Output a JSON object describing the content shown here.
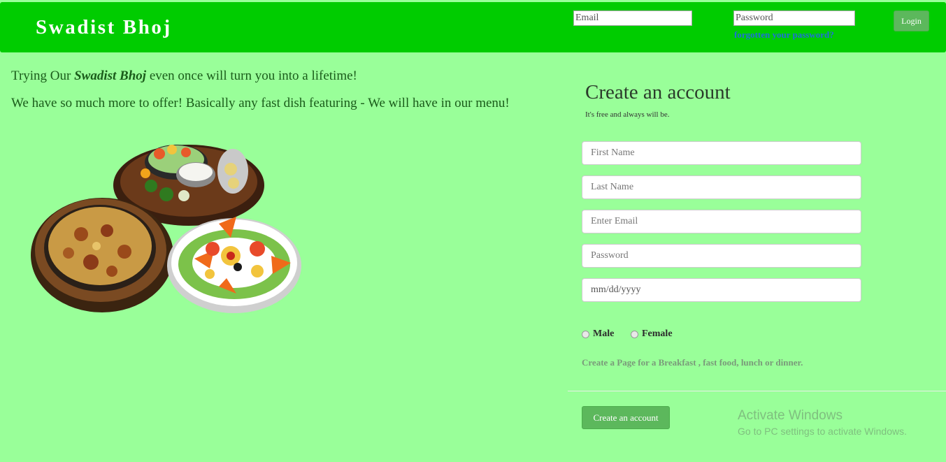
{
  "header": {
    "brand": "Swadist Bhoj",
    "email_placeholder": "Email",
    "password_placeholder": "Password",
    "forgot_link": "forgotten your password?",
    "login_label": "Login"
  },
  "promo": {
    "line1_prefix": "Trying Our ",
    "line1_brand": "Swadist Bhoj",
    "line1_suffix": " even once will turn you into a lifetime!",
    "line2": "We have so much more to offer! Basically any fast dish featuring - We will have in our menu!"
  },
  "signup": {
    "title": "Create an account",
    "subtitle": "It's free and always will be.",
    "first_name_placeholder": "First Name",
    "last_name_placeholder": "Last Name",
    "email_placeholder": "Enter Email",
    "password_placeholder": "Password",
    "date_text": "mm/dd/yyyy",
    "gender_male": "Male",
    "gender_female": "Female",
    "page_note": "Create a Page for a Breakfast , fast food, lunch or dinner.",
    "submit_label": "Create an account"
  },
  "watermark": {
    "title": "Activate Windows",
    "subtitle": "Go to PC settings to activate Windows."
  },
  "colors": {
    "page_bg": "#99ff99",
    "header_bg": "#00cc00",
    "button_green": "#5cb85c",
    "link_blue": "#1e6fd9"
  }
}
